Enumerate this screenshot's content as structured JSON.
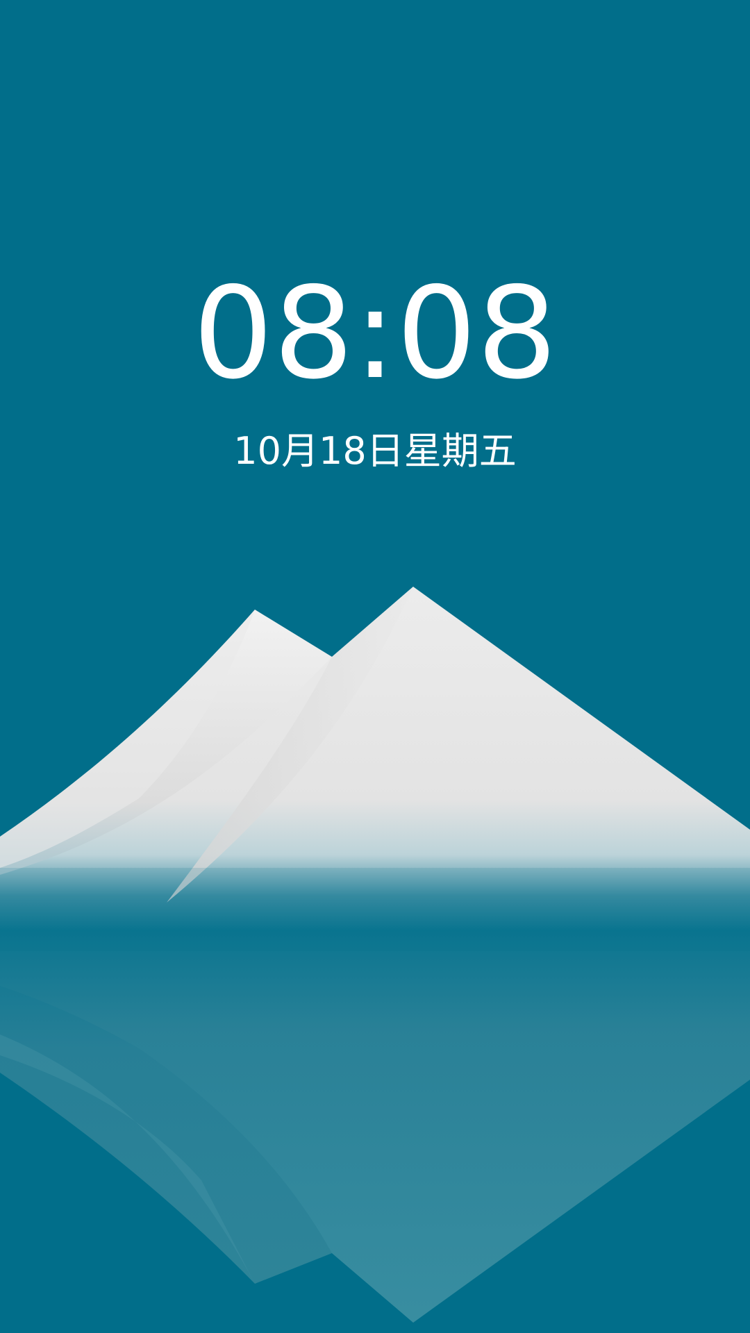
{
  "lockscreen": {
    "time": "08:08",
    "date": "10月18日星期五"
  },
  "wallpaper": {
    "name": "snow-mountain-lake-wallpaper",
    "background_color": "#016e8a",
    "mountain_color": "#e6e6e6",
    "reflection_color": "#3a8da0"
  }
}
